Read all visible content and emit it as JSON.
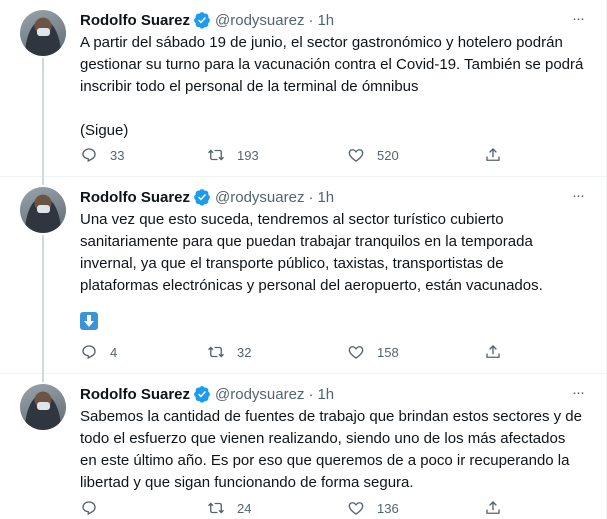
{
  "tweets": [
    {
      "author": "Rodolfo Suarez",
      "handle": "@rodysuarez",
      "dot": "·",
      "time": "1h",
      "more": "···",
      "text": "A partir del sábado 19 de junio, el sector gastronómico y hotelero podrán gestionar su turno para la vacunación contra el Covid-19. También se podrá inscribir todo el personal de la terminal de ómnibus\n\n(Sigue)",
      "replies": "33",
      "retweets": "193",
      "likes": "520"
    },
    {
      "author": "Rodolfo Suarez",
      "handle": "@rodysuarez",
      "dot": "·",
      "time": "1h",
      "more": "···",
      "text": "Una vez que esto suceda, tendremos al sector turístico cubierto sanitariamente para que puedan trabajar tranquilos en la temporada invernal, ya que el transporte público, taxistas, transportistas de plataformas electrónicas y personal del aeropuerto, están vacunados.",
      "emoji": "down-arrow-emoji",
      "replies": "4",
      "retweets": "32",
      "likes": "158"
    },
    {
      "author": "Rodolfo Suarez",
      "handle": "@rodysuarez",
      "dot": "·",
      "time": "1h",
      "more": "···",
      "text": "Sabemos la cantidad de fuentes de trabajo que brindan estos sectores y de todo el esfuerzo que vienen realizando, siendo uno de los más afectados en este último año. Es por eso que queremos de a poco ir recuperando la libertad y que sigan funcionando de forma segura.",
      "replies": "",
      "retweets": "24",
      "likes": "136"
    }
  ],
  "colors": {
    "accent": "#1d9bf0",
    "muted": "#536471",
    "text": "#0f1419",
    "thread_line": "#cfd9de"
  }
}
